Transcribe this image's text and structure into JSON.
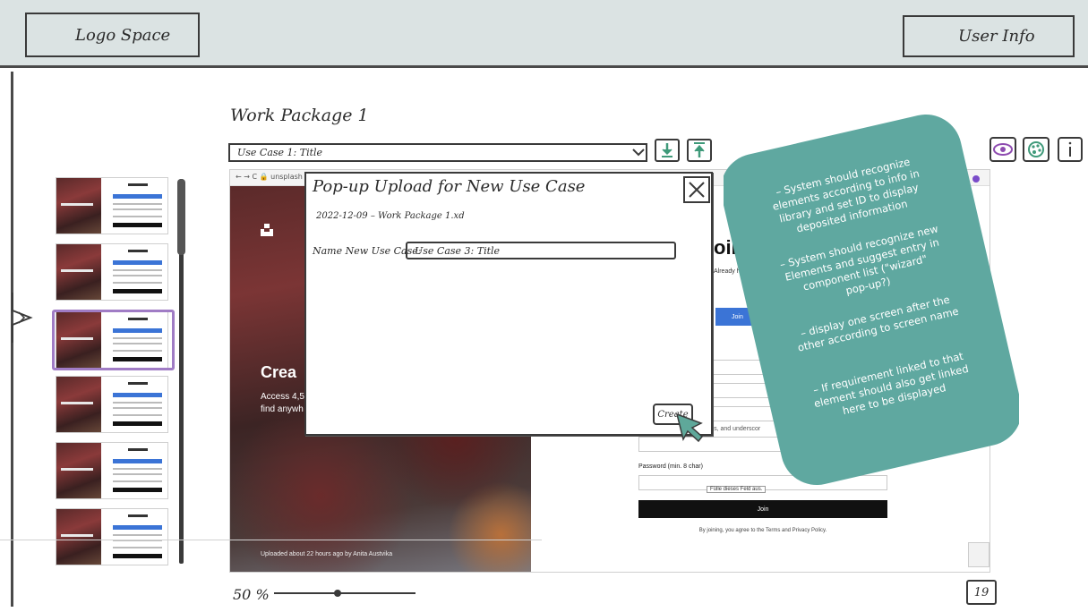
{
  "header": {
    "logo_label": "Logo Space",
    "user_label": "User Info"
  },
  "workspace": {
    "title": "Work Package 1",
    "use_case_select_value": "Use Case 1: Title"
  },
  "preview": {
    "url_fragment": "← → C  🔒 unsplash",
    "headline": "Crea",
    "subline_1": "Access 4,5",
    "subline_2": "find anywh",
    "photo_credit": "Uploaded about 22 hours ago by Anita Austvika",
    "join_heading": "oin",
    "already_text": "Already h",
    "facebook_button": "Join",
    "hint_text": "bers, and underscor",
    "password_label": "Password (min. 8 char)",
    "password_tooltip": "Fülle dieses Feld aus.",
    "join_button": "Join",
    "terms_text": "By joining, you agree to the Terms and Privacy Policy."
  },
  "modal": {
    "title": "Pop-up Upload for New Use Case",
    "file_name": "2022-12-09 – Work Package 1.xd",
    "name_label": "Name New Use Case:",
    "name_value": "Use Case 3: Title",
    "create_button": "Create"
  },
  "note": {
    "items": [
      "System should recognize elements according to info in library and set ID to display deposited information",
      "System should recognize new Elements and suggest entry in component list (\"wizard\" pop-up?)",
      "display one screen after the other according to screen name",
      "If requirement linked to that element should also get linked here to be displayed"
    ],
    "color": "#5fa8a0"
  },
  "footer": {
    "zoom_label": "50 %",
    "zoom_fraction": 0.45,
    "page_count": "19"
  },
  "thumbnails": {
    "count": 6,
    "selected_index": 2
  },
  "colors": {
    "topbar": "#dbe3e3",
    "selection": "#a07cc5",
    "accent_green": "#3f9a7a",
    "eye_purple": "#8e4cb0"
  }
}
